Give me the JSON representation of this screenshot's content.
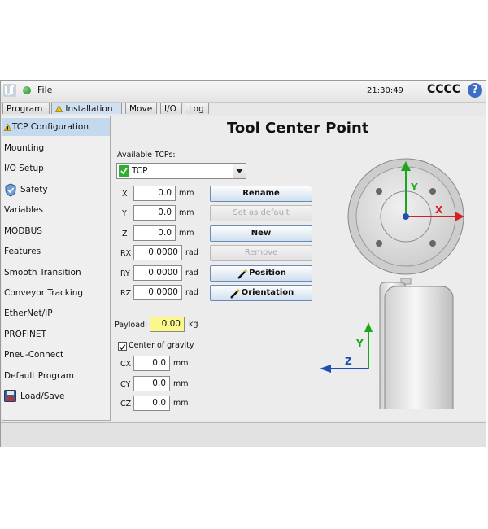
{
  "topbar": {
    "file_label": "File",
    "time": "21:30:49",
    "robot_name": "CCCC",
    "help_label": "?"
  },
  "tabs": [
    {
      "label": "Program"
    },
    {
      "label": "Installation",
      "warning": true
    },
    {
      "label": "Move"
    },
    {
      "label": "I/O"
    },
    {
      "label": "Log"
    }
  ],
  "sidebar": {
    "items": [
      {
        "label": "TCP Configuration",
        "icon": "warning-icon",
        "selected": true
      },
      {
        "label": "Mounting"
      },
      {
        "label": "I/O Setup"
      },
      {
        "label": "Safety",
        "icon": "shield-icon"
      },
      {
        "label": "Variables"
      },
      {
        "label": "MODBUS"
      },
      {
        "label": "Features"
      },
      {
        "label": "Smooth Transition"
      },
      {
        "label": "Conveyor Tracking"
      },
      {
        "label": "EtherNet/IP"
      },
      {
        "label": "PROFINET"
      },
      {
        "label": "Pneu-Connect"
      },
      {
        "label": "Default Program"
      },
      {
        "label": "Load/Save",
        "icon": "floppy-disk-icon"
      }
    ]
  },
  "main": {
    "title": "Tool Center Point",
    "available_label": "Available TCPs:",
    "selected_tcp": "TCP",
    "fields": [
      {
        "label": "X",
        "value": "0.0",
        "unit": "mm"
      },
      {
        "label": "Y",
        "value": "0.0",
        "unit": "mm"
      },
      {
        "label": "Z",
        "value": "0.0",
        "unit": "mm"
      },
      {
        "label": "RX",
        "value": "0.0000",
        "unit": "rad"
      },
      {
        "label": "RY",
        "value": "0.0000",
        "unit": "rad"
      },
      {
        "label": "RZ",
        "value": "0.0000",
        "unit": "rad"
      }
    ],
    "buttons": [
      {
        "label": "Rename",
        "enabled": true
      },
      {
        "label": "Set as default",
        "enabled": false
      },
      {
        "label": "New",
        "enabled": true
      },
      {
        "label": "Remove",
        "enabled": false
      },
      {
        "label": "Position",
        "enabled": true,
        "icon": "wand-icon"
      },
      {
        "label": "Orientation",
        "enabled": true,
        "icon": "wand-icon"
      }
    ],
    "payload": {
      "label": "Payload:",
      "value": "0.00",
      "unit": "kg"
    },
    "cog": {
      "label": "Center of gravity",
      "checked": true
    },
    "cog_fields": [
      {
        "label": "CX",
        "value": "0.0",
        "unit": "mm"
      },
      {
        "label": "CY",
        "value": "0.0",
        "unit": "mm"
      },
      {
        "label": "CZ",
        "value": "0.0",
        "unit": "mm"
      }
    ],
    "diagram": {
      "axis_x": "X",
      "axis_y": "Y",
      "axis_z": "Z",
      "axis_y2": "Y",
      "colors": {
        "x": "#d42020",
        "y": "#1aa51a",
        "z": "#1f4fb3"
      }
    }
  }
}
